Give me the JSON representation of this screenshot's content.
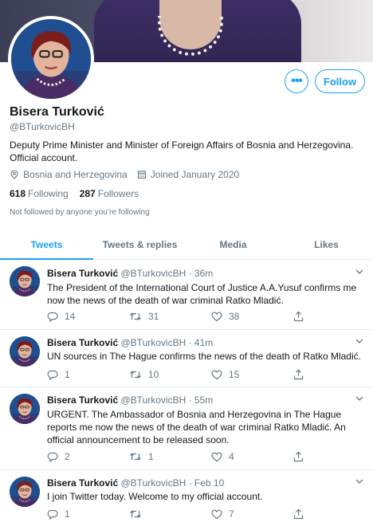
{
  "profile": {
    "name": "Bisera Turković",
    "handle": "@BTurkovicBH",
    "bio": "Deputy Prime Minister and Minister of  Foreign Affairs of Bosnia and Herzegovina. Official account.",
    "location": "Bosnia and Herzegovina",
    "joined": "Joined January 2020",
    "following_count": "618",
    "following_label": "Following",
    "followers_count": "287",
    "followers_label": "Followers",
    "not_followed_text": "Not followed by anyone you’re following"
  },
  "buttons": {
    "more_label": "•••",
    "follow_label": "Follow"
  },
  "tabs": [
    {
      "label": "Tweets",
      "active": true
    },
    {
      "label": "Tweets & replies",
      "active": false
    },
    {
      "label": "Media",
      "active": false
    },
    {
      "label": "Likes",
      "active": false
    }
  ],
  "tweets": [
    {
      "name": "Bisera Turković",
      "handle": "@BTurkovicBH",
      "time": "· 36m",
      "text": "The President of the International Court of Justice A.A.Yusuf confirms me now the news of the death of war criminal Ratko Mladić.",
      "replies": "14",
      "retweets": "31",
      "likes": "38"
    },
    {
      "name": "Bisera Turković",
      "handle": "@BTurkovicBH",
      "time": "· 41m",
      "text": "UN sources in The Hague confirms the news of the death of Ratko Mladić.",
      "replies": "1",
      "retweets": "10",
      "likes": "15"
    },
    {
      "name": "Bisera Turković",
      "handle": "@BTurkovicBH",
      "time": "· 55m",
      "text": "URGENT. The Ambassador of Bosnia and Herzegovina in The Hague reports me now the news of the death of war criminal Ratko Mladić. An official announcement to be released soon.",
      "replies": "2",
      "retweets": "1",
      "likes": "4"
    },
    {
      "name": "Bisera Turković",
      "handle": "@BTurkovicBH",
      "time": "· Feb 10",
      "text": "I join Twitter today. Welcome to my official account.",
      "replies": "1",
      "retweets": "",
      "likes": "7"
    }
  ],
  "colors": {
    "accent": "#1da1f2",
    "muted": "#657786",
    "text": "#14171a",
    "border": "#e6ecf0"
  },
  "icons": [
    "location-pin-icon",
    "calendar-icon",
    "reply-icon",
    "retweet-icon",
    "like-icon",
    "share-icon",
    "chevron-down-icon",
    "more-icon"
  ]
}
